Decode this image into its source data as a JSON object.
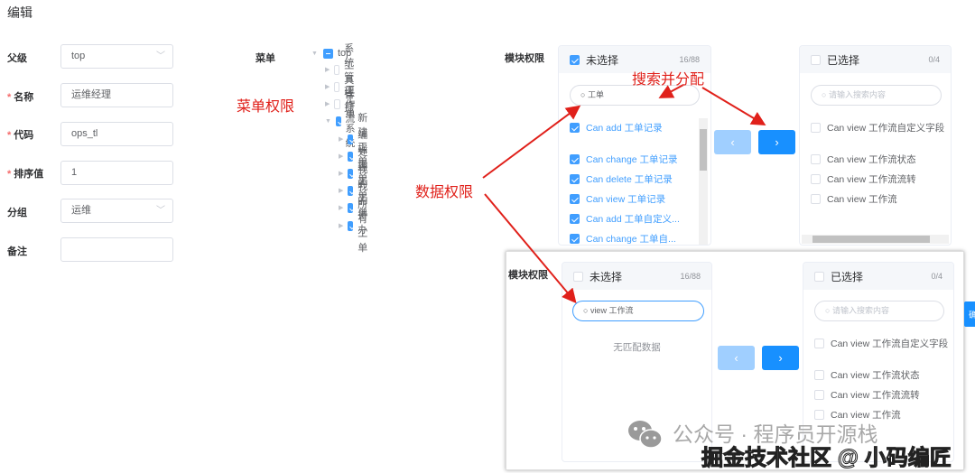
{
  "title": "编辑",
  "form": {
    "parent": {
      "label": "父级",
      "value": "top"
    },
    "name": {
      "label": "名称",
      "value": "运维经理"
    },
    "code": {
      "label": "代码",
      "value": "ops_tl"
    },
    "order": {
      "label": "排序值",
      "value": "1"
    },
    "group": {
      "label": "分组",
      "value": "运维"
    },
    "remark": {
      "label": "备注",
      "value": ""
    }
  },
  "menu": {
    "label": "菜单",
    "tree": [
      {
        "label": "top",
        "state": "indeterminate"
      },
      {
        "label": "系统管理",
        "state": "off"
      },
      {
        "label": "工具管理",
        "state": "off"
      },
      {
        "label": "工作流",
        "state": "off"
      },
      {
        "label": "工单系统",
        "state": "on"
      },
      {
        "label": "新建工单",
        "state": "on"
      },
      {
        "label": "编辑工单",
        "state": "on"
      },
      {
        "label": "处理工单",
        "state": "on"
      },
      {
        "label": "我的工单",
        "state": "on"
      },
      {
        "label": "我的待办",
        "state": "on"
      },
      {
        "label": "所有工单",
        "state": "on"
      }
    ]
  },
  "annotations": {
    "menu_perm": "菜单权限",
    "data_perm": "数据权限",
    "search_assign": "搜索并分配"
  },
  "transfer_top": {
    "label": "模块权限",
    "left": {
      "title": "未选择",
      "count": "16/88",
      "search": "工单",
      "items": [
        "Can add 工单记录",
        "Can change 工单记录",
        "Can delete 工单记录",
        "Can view 工单记录",
        "Can add 工单自定义...",
        "Can change 工单自..."
      ]
    },
    "right": {
      "title": "已选择",
      "count": "0/4",
      "search_placeholder": "请输入搜索内容",
      "items": [
        "Can view 工作流自定义字段",
        "Can view 工作流状态",
        "Can view 工作流流转",
        "Can view 工作流"
      ]
    },
    "prev": "‹",
    "next": "›"
  },
  "transfer_bottom": {
    "label": "模块权限",
    "left": {
      "title": "未选择",
      "count": "16/88",
      "search": "view 工作流",
      "empty": "无匹配数据"
    },
    "right": {
      "title": "已选择",
      "count": "0/4",
      "search_placeholder": "请输入搜索内容",
      "items": [
        "Can view 工作流自定义字段",
        "Can view 工作流状态",
        "Can view 工作流流转",
        "Can view 工作流"
      ]
    },
    "prev": "‹",
    "next": "›",
    "side_tab": "确"
  },
  "watermark": {
    "line1": "公众号 · 程序员开源栈",
    "line2": "掘金技术社区 @ 小码编匠"
  },
  "colors": {
    "primary": "#1890ff",
    "annotation": "#e0201a"
  }
}
